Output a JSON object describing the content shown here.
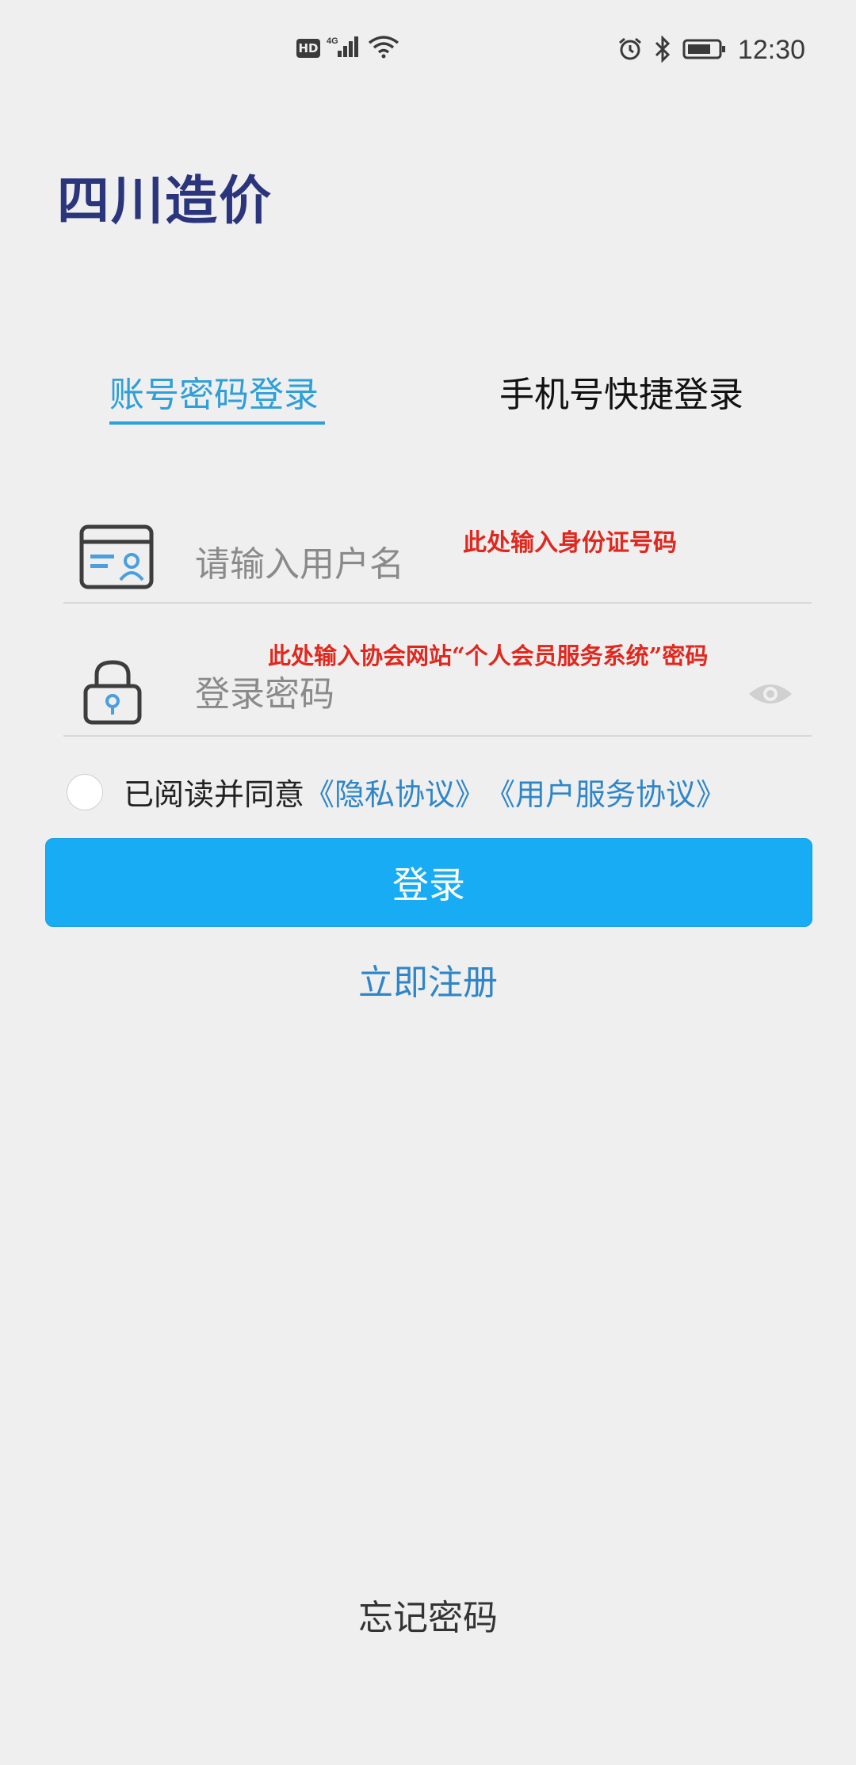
{
  "status_bar": {
    "hd": "HD",
    "network": "4G",
    "time": "12:30"
  },
  "app": {
    "title": "四川造价"
  },
  "tabs": [
    {
      "label": "账号密码登录",
      "active": true
    },
    {
      "label": "手机号快捷登录",
      "active": false
    }
  ],
  "form": {
    "username_placeholder": "请输入用户名",
    "password_placeholder": "登录密码"
  },
  "annotations": {
    "username_note": "此处输入身份证号码",
    "password_note": "此处输入协会网站“个人会员服务系统”密码"
  },
  "agreement": {
    "prefix": "已阅读并同意",
    "privacy_link": "《隐私协议》",
    "service_link": "《用户服务协议》"
  },
  "buttons": {
    "login": "登录",
    "register": "立即注册",
    "forgot": "忘记密码"
  },
  "colors": {
    "title": "#2b357c",
    "accent": "#2e9fd8",
    "button": "#17acf3",
    "link": "#2e86c8",
    "annotation": "#e0281e"
  }
}
